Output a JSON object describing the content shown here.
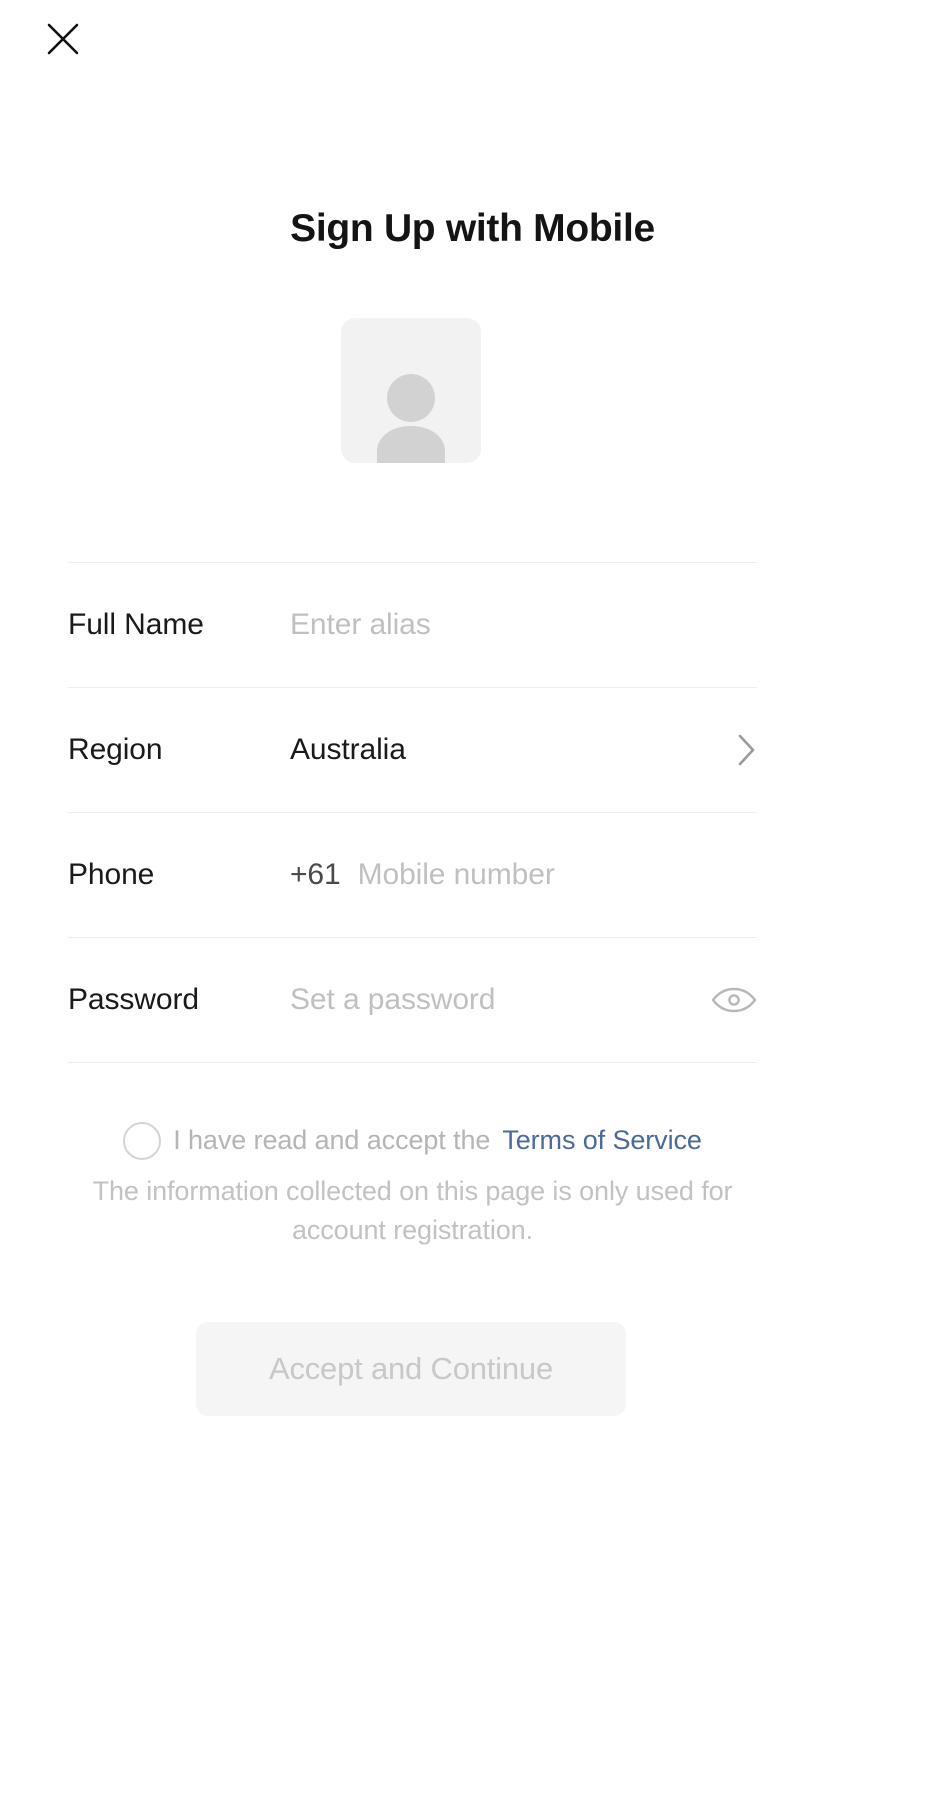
{
  "header": {
    "close_icon": "close-icon",
    "title": "Sign Up with Mobile"
  },
  "avatar": {
    "icon": "person-placeholder-icon",
    "alt": "Profile photo placeholder"
  },
  "form": {
    "rows": [
      {
        "label": "Full Name",
        "placeholder": "Enter alias",
        "value": "",
        "type": "text",
        "trailing_icon": ""
      },
      {
        "label": "Region",
        "placeholder": "",
        "value": "Australia",
        "type": "select",
        "trailing_icon": "chevron-right-icon"
      },
      {
        "label": "Phone",
        "placeholder": "Mobile number",
        "value": "",
        "dial_code": "+61",
        "type": "tel",
        "trailing_icon": ""
      },
      {
        "label": "Password",
        "placeholder": "Set a password",
        "value": "",
        "type": "password",
        "trailing_icon": "eye-icon"
      }
    ]
  },
  "terms": {
    "checkbox_state": "unchecked",
    "consent_text": "I have read and accept the",
    "link_text": "Terms of Service",
    "note": "The information collected on this page is only used for account registration."
  },
  "submit": {
    "label": "Accept and Continue",
    "enabled": false
  },
  "colors": {
    "text_primary": "#1a1a1a",
    "text_placeholder": "#c0c0c0",
    "link": "#4a6b99",
    "divider": "#eeeeee",
    "avatar_bg": "#f2f2f2",
    "avatar_glyph": "#d2d2d2",
    "button_bg": "#f5f5f5",
    "button_text": "#c8c8c8"
  }
}
